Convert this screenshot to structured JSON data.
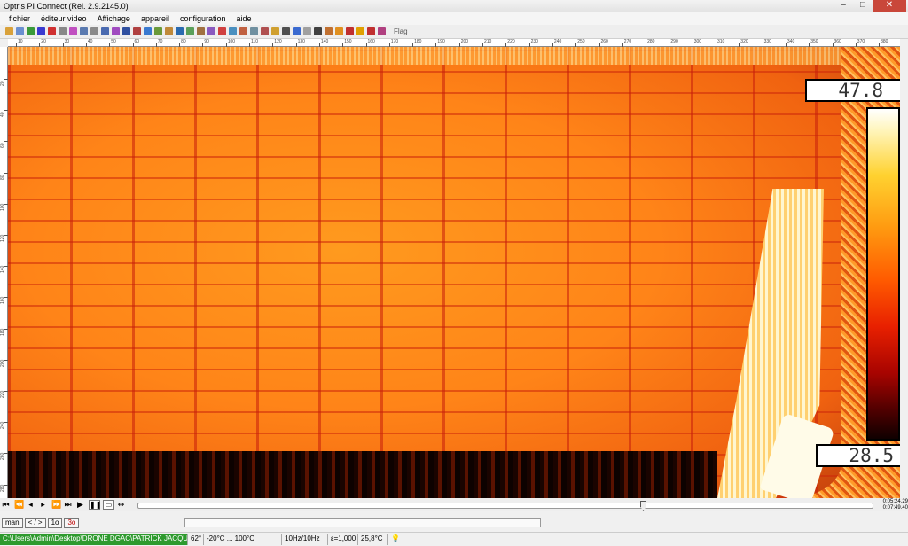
{
  "window": {
    "title": "Optris PI Connect (Rel. 2.9.2145.0)"
  },
  "menu": {
    "items": [
      "fichier",
      "éditeur video",
      "Affichage",
      "appareil",
      "configuration",
      "aide"
    ]
  },
  "toolbar": {
    "flag_label": "Flag"
  },
  "ruler": {
    "h_labels": [
      "10",
      "20",
      "30",
      "40",
      "50",
      "60",
      "70",
      "80",
      "90",
      "100",
      "110",
      "120",
      "130",
      "140",
      "150",
      "160",
      "170",
      "180",
      "190",
      "200",
      "210",
      "220",
      "230",
      "240",
      "250",
      "260",
      "270",
      "280",
      "290",
      "300",
      "310",
      "320",
      "330",
      "340",
      "350",
      "360",
      "370",
      "380"
    ],
    "v_labels": [
      "20",
      "40",
      "60",
      "80",
      "100",
      "120",
      "140",
      "160",
      "180",
      "200",
      "220",
      "240",
      "260",
      "280"
    ]
  },
  "thermal": {
    "max_temp": "47.8",
    "min_temp": "28.5"
  },
  "playback": {
    "time_current": "0:05:24.29",
    "time_total": "0:07:49.40",
    "position_fraction": 0.69
  },
  "controls": {
    "man_label": "man",
    "arrow_label": "< / >",
    "one_label": "1o",
    "three_label": "3o"
  },
  "status": {
    "file_path": "C:\\Users\\Admin\\Desktop\\DRONE DGAC\\PATRICK JACQUES.ravi",
    "fov": "62°",
    "range": "-20°C ... 100°C",
    "frequency": "10Hz/10Hz",
    "emissivity": "ε=1,000",
    "ambient_temp": "25,8°C"
  }
}
